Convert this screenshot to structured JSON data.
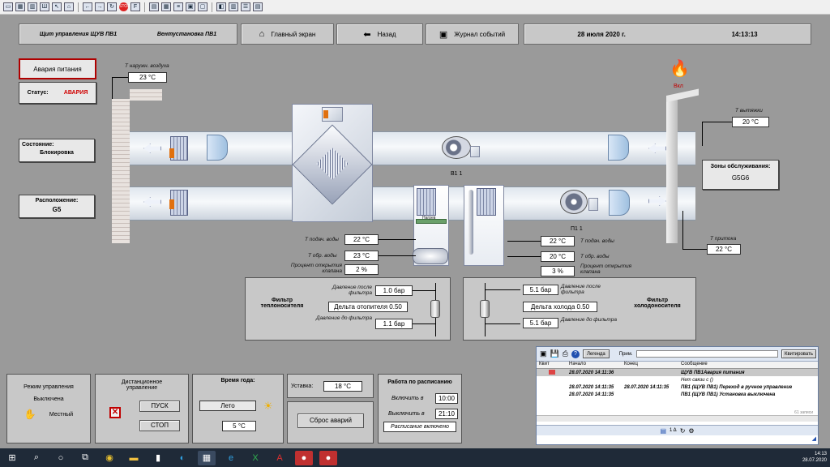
{
  "header": {
    "panel_title": "Щит управления ЩУВ ПВ1",
    "unit_title": "Вентустановка ПВ1",
    "main_screen": "Главный экран",
    "back": "Назад",
    "event_log": "Журнал событий",
    "date": "28 июля 2020 г.",
    "time": "14:13:13"
  },
  "left": {
    "power_alarm": "Авария питания",
    "status_label": "Статус:",
    "status_value": "АВАРИЯ",
    "state_label": "Состояние:",
    "state_value": "Блокировка",
    "location_label": "Расположение:",
    "location_value": "G5"
  },
  "sensors": {
    "outdoor_label": "Т наружн. воздуха",
    "outdoor_value": "23 °C",
    "fire_label": "Вкл",
    "exhaust_label": "Т вытяжки",
    "exhaust_value": "20 °C",
    "zones_label": "Зоны обслуживания:",
    "zones_value": "G5G6",
    "supply_label": "Т притока",
    "supply_value": "22 °C",
    "fan_exhaust_label": "В1 1",
    "fan_supply_label": "П1 1",
    "valve_label": "Нагрев"
  },
  "heater": {
    "supply_water_label": "Т подач. воды",
    "supply_water_value": "22 °C",
    "return_water_label": "Т обр. воды",
    "return_water_value": "23 °C",
    "valve_open_label": "Процент открытия клапана",
    "valve_open_value": "2 %"
  },
  "cooler": {
    "supply_water_label": "Т подач. воды",
    "supply_water_value": "22 °C",
    "return_water_label": "Т обр. воды",
    "return_water_value": "20 °C",
    "valve_open_label": "Процент открытия клапана",
    "valve_open_value": "3 %"
  },
  "heat_filter": {
    "title": "Фильтр теплоносителя",
    "after_label": "Давление после фильтра",
    "after_value": "1.0 бар",
    "delta": "Дельта отопителя  0.50",
    "before_label": "Давление до фильтра",
    "before_value": "1.1 бар"
  },
  "cold_filter": {
    "title": "Фильтр холодоносителя",
    "after_label": "Давление после фильтра",
    "after_value": "5.1 бар",
    "delta": "Дельта холода  0.50",
    "before_label": "Давление до фильтра",
    "before_value": "5.1 бар"
  },
  "bottom": {
    "mode_title": "Режим управления",
    "mode_state": "Выключена",
    "mode_local": "Местный",
    "remote_title": "Дистанционное управление",
    "start": "ПУСК",
    "stop": "СТОП",
    "season_title": "Время года:",
    "season_value": "Лето",
    "season_temp": "5 °C",
    "setpoint_label": "Уставка:",
    "setpoint_value": "18 °C",
    "reset": "Сброс аварий",
    "schedule_title": "Работа по расписанию",
    "on_label": "Включить в",
    "on_value": "10:00",
    "off_label": "Выключить в",
    "off_value": "21:10",
    "schedule_state": "Расписание включено"
  },
  "events": {
    "legend": "Легенда",
    "comment": "Прим.",
    "ack": "Квитировать",
    "headers": [
      "Квит",
      "Начало",
      "Конец",
      "Сообщение"
    ],
    "rows": [
      {
        "start": "28.07.2020 14:11:36",
        "end": "",
        "msg": "ЩУВ ПВ1Авария питания"
      },
      {
        "start": "",
        "end": "",
        "msg": "Нет связи с ()"
      },
      {
        "start": "28.07.2020 14:11:35",
        "end": "28.07.2020 14:11:35",
        "msg": "ПВ1 (ЩУВ ПВ1) Переход в ручное управление"
      },
      {
        "start": "28.07.2020 14:11:35",
        "end": "",
        "msg": "ПВ1 (ЩУВ ПВ1) Установка выключена"
      }
    ],
    "count": "61 записи",
    "status_mid": "1 Δ"
  },
  "taskbar": {
    "time": "14:13",
    "date": "28.07.2020"
  }
}
